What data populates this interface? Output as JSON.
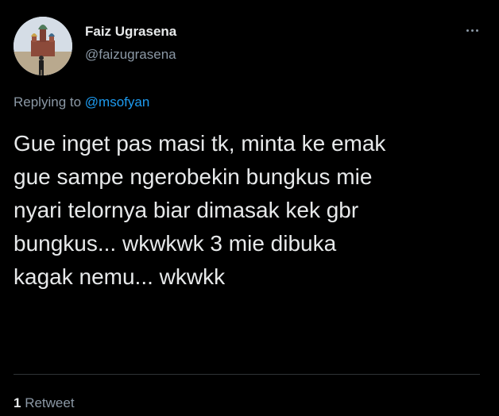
{
  "author": {
    "display_name": "Faiz Ugrasena",
    "handle": "@faizugrasena"
  },
  "more_icon": "more-horizontal-icon",
  "reply": {
    "prefix": "Replying to",
    "mention": "@msofyan"
  },
  "tweet": {
    "text": "Gue inget pas masi tk, minta ke emak\ngue sampe ngerobekin bungkus mie\nnyari telornya biar dimasak kek gbr\nbungkus... wkwkwk 3 mie dibuka\nkagak nemu... wkwkk"
  },
  "stats": {
    "retweet_count": "1",
    "retweet_label": "Retweet"
  },
  "colors": {
    "background": "#000000",
    "text": "#e7e9ea",
    "secondary": "#8b98a5",
    "accent": "#1d9bf0",
    "divider": "#2f3336"
  }
}
